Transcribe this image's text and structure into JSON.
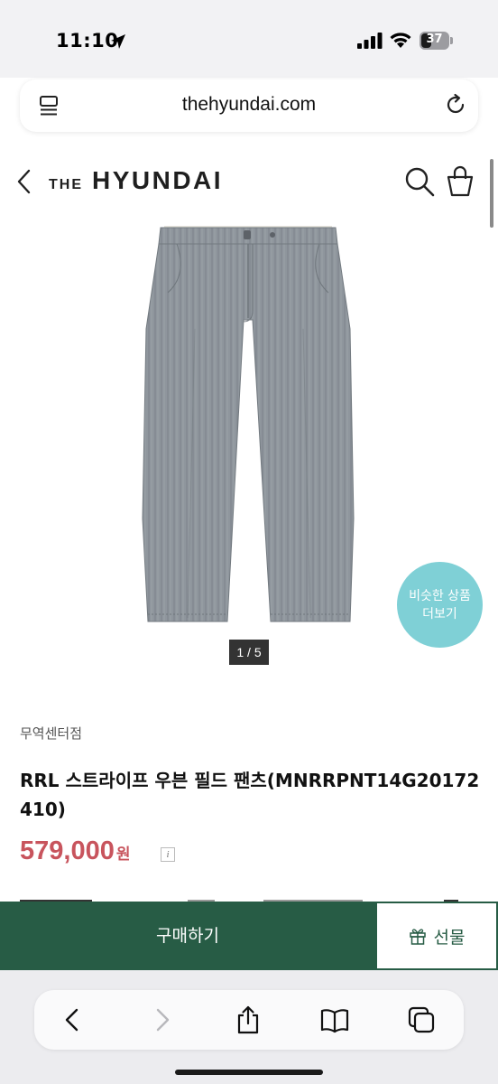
{
  "status_bar": {
    "time": "11:10",
    "battery_level": "37",
    "battery_fraction": 0.37
  },
  "browser": {
    "url": "thehyundai.com"
  },
  "header": {
    "logo_prefix": "THE",
    "logo_main": "HYUNDAI"
  },
  "product": {
    "image_counter": "1 / 5",
    "similar_line1": "비슷한 상품",
    "similar_line2": "더보기",
    "store": "무역센터점",
    "title": "RRL 스트라이프 우븐 필드 팬츠(MNRRPNT14G20172410)",
    "price": "579,000",
    "price_unit": "원",
    "info_glyph": "i"
  },
  "actions": {
    "buy_label": "구매하기",
    "gift_label": "선물"
  },
  "colors": {
    "brand_green": "#275c45",
    "price_red": "#c8545d",
    "similar_badge": "#7fd0d6"
  },
  "icons": [
    "location-arrow-icon",
    "signal-icon",
    "wifi-icon",
    "battery-icon",
    "tab-list-icon",
    "reload-icon",
    "back-icon",
    "search-icon",
    "shopping-bag-icon",
    "gift-icon",
    "browser-back-icon",
    "browser-forward-icon",
    "share-icon",
    "bookmarks-icon",
    "tabs-icon"
  ]
}
